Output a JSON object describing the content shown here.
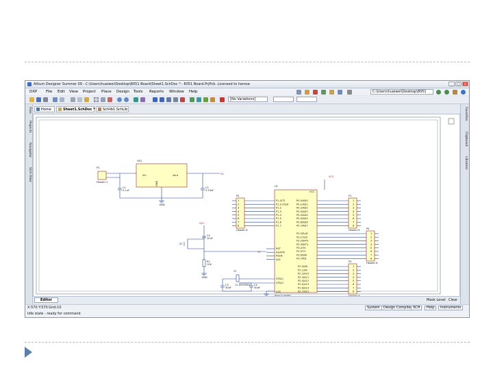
{
  "window": {
    "title": "Altium Designer Summer 09 - C:\\Users\\huaiwei\\Desktop\\8051 Board\\Sheet1.SchDoc * - 8051 Board.PrjPcb. Licensed to horose",
    "controls": [
      "_",
      "□",
      "x"
    ]
  },
  "menu": {
    "items": [
      "DXP",
      "File",
      "Edit",
      "View",
      "Project",
      "Place",
      "Design",
      "Tools",
      "Reports",
      "Window",
      "Help"
    ]
  },
  "toolbar": {
    "path_field": "C:\\Users\\huaiwei\\Desktop\\8051",
    "variations_field": "[No Variations]"
  },
  "left_panel": {
    "tabs": [
      "Files",
      "Projects",
      "Navigator",
      "SCH Filter"
    ]
  },
  "right_panel": {
    "tabs": [
      "Favorites",
      "Clipboard",
      "Libraries"
    ]
  },
  "doc_tabs": [
    {
      "label": "Home"
    },
    {
      "label": "Sheet1.SchDoc *"
    },
    {
      "label": "Schlib1.SchLib"
    }
  ],
  "schematic": {
    "p2": {
      "ref": "P2",
      "name": "Header 2"
    },
    "vr1": {
      "ref": "VR1",
      "pins": [
        "Vin",
        "Vout",
        "GND"
      ]
    },
    "c1": {
      "ref": "C1",
      "value": "0.1uF"
    },
    "c2": {
      "ref": "C2",
      "value": "0.33uF"
    },
    "vcc": "VCC",
    "net_5v": "5V",
    "gnd": "GND",
    "p4": {
      "ref": "P4",
      "name": "Header 8"
    },
    "p3": {
      "ref": "P3",
      "name": "Header 8"
    },
    "p1": {
      "ref": "P1",
      "name": "Header 8"
    },
    "p5": {
      "ref": "P5",
      "name": "Header 8"
    },
    "s1": "S1",
    "c5": {
      "ref": "C5",
      "value": "10uF"
    },
    "r1": {
      "ref": "R1",
      "value": "10K"
    },
    "y1": {
      "ref": "Y1",
      "value": "11.0592MHz"
    },
    "c3": {
      "ref": "C3",
      "value": "30pF"
    },
    "c4": {
      "ref": "C4",
      "value": "30pF"
    },
    "u1": {
      "ref": "U1",
      "part": "P89C51RBPN",
      "vcc": "VCC",
      "vss": "VSS",
      "left_pins": [
        "P1.0/T2",
        "P1.1/T2EX",
        "P1.2",
        "P1.3",
        "P1.4",
        "P1.5",
        "P1.6",
        "P1.7"
      ],
      "right_top": [
        "P0.0/AD0",
        "P0.1/AD1",
        "P0.2/AD2",
        "P0.3/AD3",
        "P0.4/AD4",
        "P0.5/AD5",
        "P0.6/AD6",
        "P0.7/AD7"
      ],
      "right_mid": [
        "P3.0/RxD",
        "P3.1/TxD",
        "P3.2/INT0",
        "P3.3/INT1",
        "P3.4/T0",
        "P3.5/T1",
        "P3.6/WR",
        "P3.7/RD"
      ],
      "right_bot": [
        "P2.0/A8",
        "P2.1/A9",
        "P2.2/A10",
        "P2.3/A11",
        "P2.4/A12",
        "P2.5/A13",
        "P2.6/A14",
        "P2.7/A15"
      ],
      "ctrl_pins": [
        "RST",
        "EA/VPP",
        "PSEN",
        "ALE"
      ],
      "xtal_pins": [
        "XTAL1",
        "XTAL2"
      ]
    },
    "header_pins": [
      "1",
      "2",
      "3",
      "4",
      "5",
      "6",
      "7",
      "8"
    ]
  },
  "editor": {
    "tab": "Editor",
    "mask_level": "Mask Level",
    "clear": "Clear"
  },
  "status": {
    "coords": "X:570 Y:570",
    "grid": "Grid:10",
    "message": "Idle state - ready for command",
    "buttons": [
      "System",
      "Design Compiler",
      "SCH",
      "Help",
      "Instruments"
    ]
  }
}
